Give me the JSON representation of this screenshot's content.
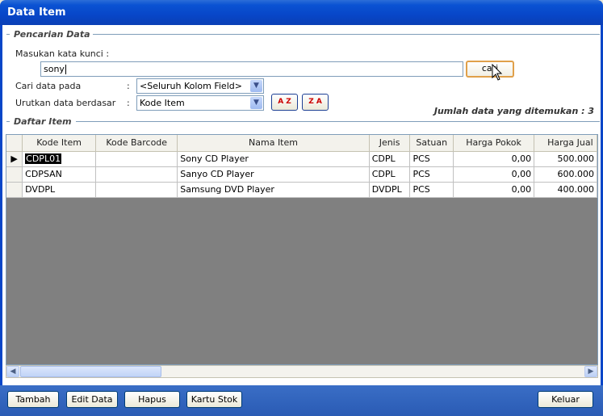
{
  "window": {
    "title": "Data Item"
  },
  "search_group": {
    "label": "Pencarian Data",
    "keyword_label": "Masukan kata kunci :",
    "keyword_value": "sony",
    "search_button": "cari",
    "search_in_label": "Cari data pada",
    "search_in_colon": ":",
    "search_in_value": "<Seluruh Kolom Field>",
    "sort_label": "Urutkan data berdasar",
    "sort_colon": ":",
    "sort_value": "Kode Item",
    "sort_asc_label": "A Z",
    "sort_desc_label": "Z A",
    "result_count": "Jumlah data yang ditemukan : 3"
  },
  "list_group": {
    "label": "Daftar Item"
  },
  "table": {
    "columns": [
      "Kode Item",
      "Kode Barcode",
      "Nama Item",
      "Jenis",
      "Satuan",
      "Harga Pokok",
      "Harga Jual"
    ],
    "rows": [
      [
        "CDPL01",
        "",
        "Sony CD Player",
        "CDPL",
        "PCS",
        "0,00",
        "500.000"
      ],
      [
        "CDPSAN",
        "",
        "Sanyo CD Player",
        "CDPL",
        "PCS",
        "0,00",
        "600.000"
      ],
      [
        "DVDPL",
        "",
        "Samsung DVD Player",
        "DVDPL",
        "PCS",
        "0,00",
        "400.000"
      ]
    ]
  },
  "buttons": {
    "add": "Tambah",
    "edit": "Edit Data",
    "delete": "Hapus",
    "stock_card": "Kartu Stok",
    "exit": "Keluar"
  },
  "colors": {
    "titlebar": "#0846c8",
    "bottombar": "#2a5bb4",
    "grid_empty": "#808080"
  }
}
